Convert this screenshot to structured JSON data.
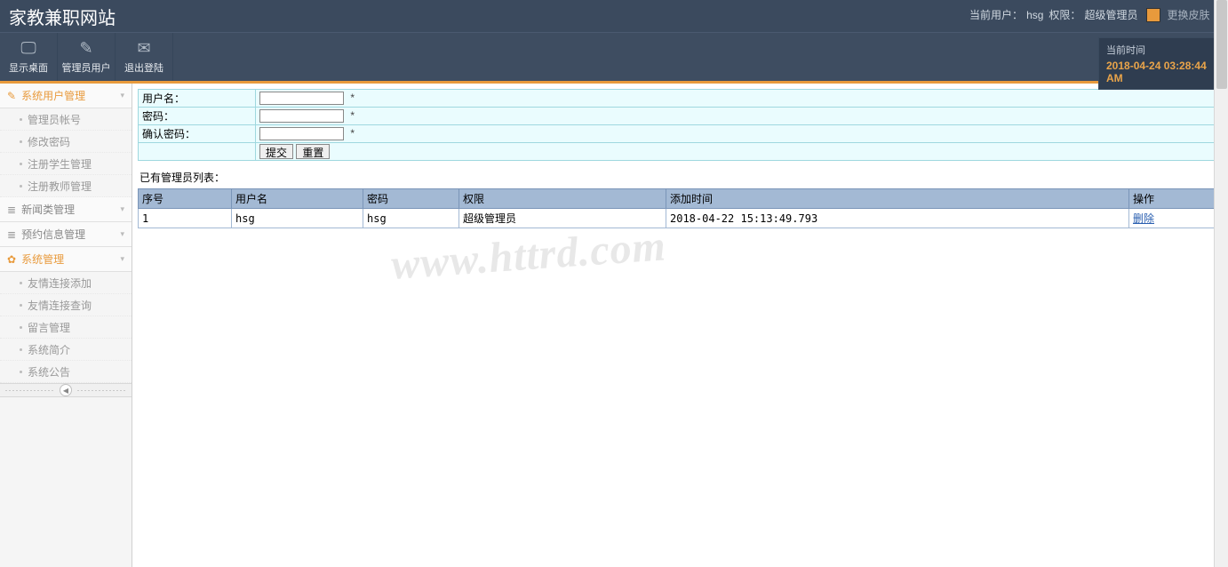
{
  "header": {
    "site_title": "家教兼职网站",
    "user_label": "当前用户：",
    "user_value": "hsg",
    "role_label": "权限：",
    "role_value": "超级管理员",
    "skin_label": "更换皮肤"
  },
  "toolbar": {
    "desktop": "显示桌面",
    "admin_user": "管理员用户",
    "logout": "退出登陆"
  },
  "clock": {
    "label": "当前时间",
    "time": "2018-04-24 03:28:44 AM"
  },
  "sidebar": {
    "groups": [
      {
        "name": "user-mgmt",
        "label": "系统用户管理",
        "icon": "✎",
        "active": true,
        "expanded": true,
        "items": [
          {
            "label": "管理员帐号"
          },
          {
            "label": "修改密码"
          },
          {
            "label": "注册学生管理"
          },
          {
            "label": "注册教师管理"
          }
        ]
      },
      {
        "name": "news-mgmt",
        "label": "新闻类管理",
        "icon": "≣",
        "active": false,
        "expanded": false,
        "items": []
      },
      {
        "name": "booking-mgmt",
        "label": "预约信息管理",
        "icon": "≣",
        "active": false,
        "expanded": false,
        "items": []
      },
      {
        "name": "sys-mgmt",
        "label": "系统管理",
        "icon": "✿",
        "active": true,
        "expanded": true,
        "items": [
          {
            "label": "友情连接添加"
          },
          {
            "label": "友情连接查询"
          },
          {
            "label": "留言管理"
          },
          {
            "label": "系统简介"
          },
          {
            "label": "系统公告"
          }
        ]
      }
    ]
  },
  "form": {
    "username_label": "用户名：",
    "password_label": "密码：",
    "confirm_label": "确认密码：",
    "required_mark": "*",
    "submit": "提交",
    "reset": "重置"
  },
  "list_caption": "已有管理员列表：",
  "table": {
    "headers": {
      "index": "序号",
      "username": "用户名",
      "password": "密码",
      "role": "权限",
      "add_time": "添加时间",
      "action": "操作"
    },
    "rows": [
      {
        "index": "1",
        "username": "hsg",
        "password": "hsg",
        "role": "超级管理员",
        "add_time": "2018-04-22 15:13:49.793",
        "action": "删除"
      }
    ]
  },
  "watermark": "www.httrd.com"
}
